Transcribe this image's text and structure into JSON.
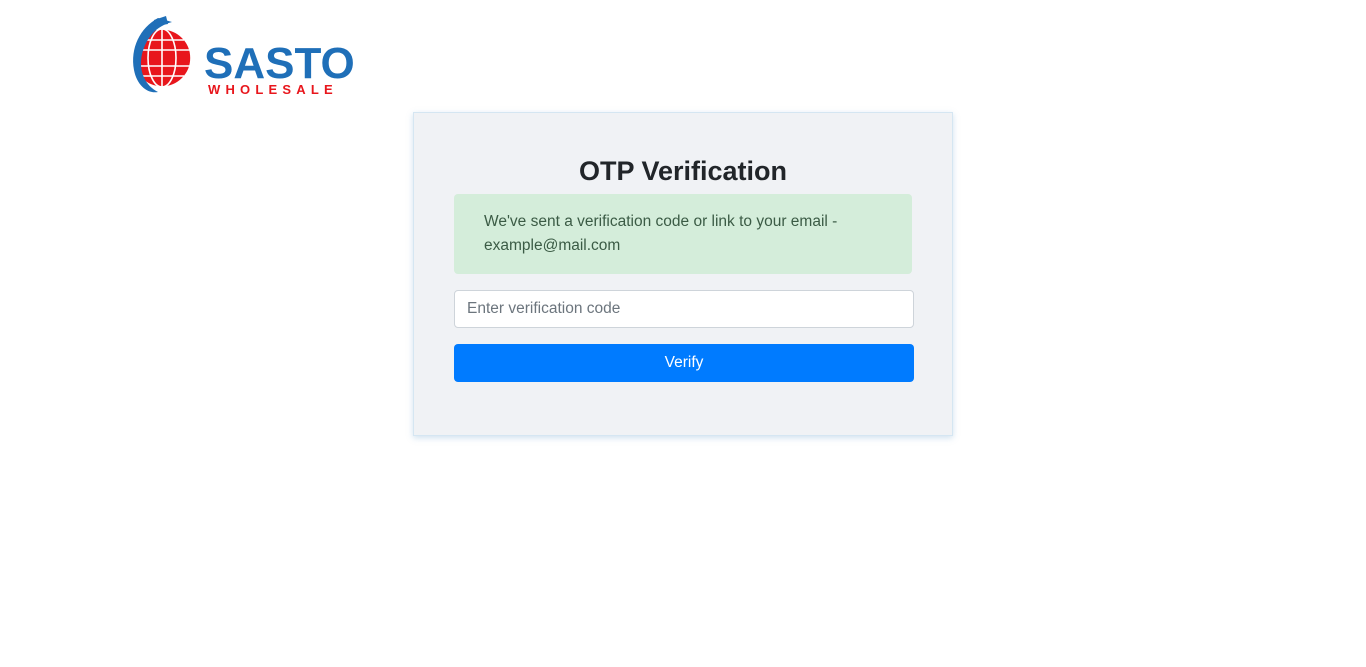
{
  "brand": {
    "name_main": "SASTO",
    "name_sub": "WHOLESALE",
    "icon": "globe-logo-icon",
    "colors": {
      "blue": "#1f6fb8",
      "red": "#e8161c"
    }
  },
  "card": {
    "title": "OTP Verification",
    "alert_message": "We've sent a verification code or link to your email - example@mail.com",
    "input_placeholder": "Enter verification code",
    "input_value": "",
    "verify_label": "Verify"
  },
  "colors": {
    "primary": "#007bff",
    "alert_bg": "#d4edda",
    "card_bg": "#f0f2f5"
  }
}
